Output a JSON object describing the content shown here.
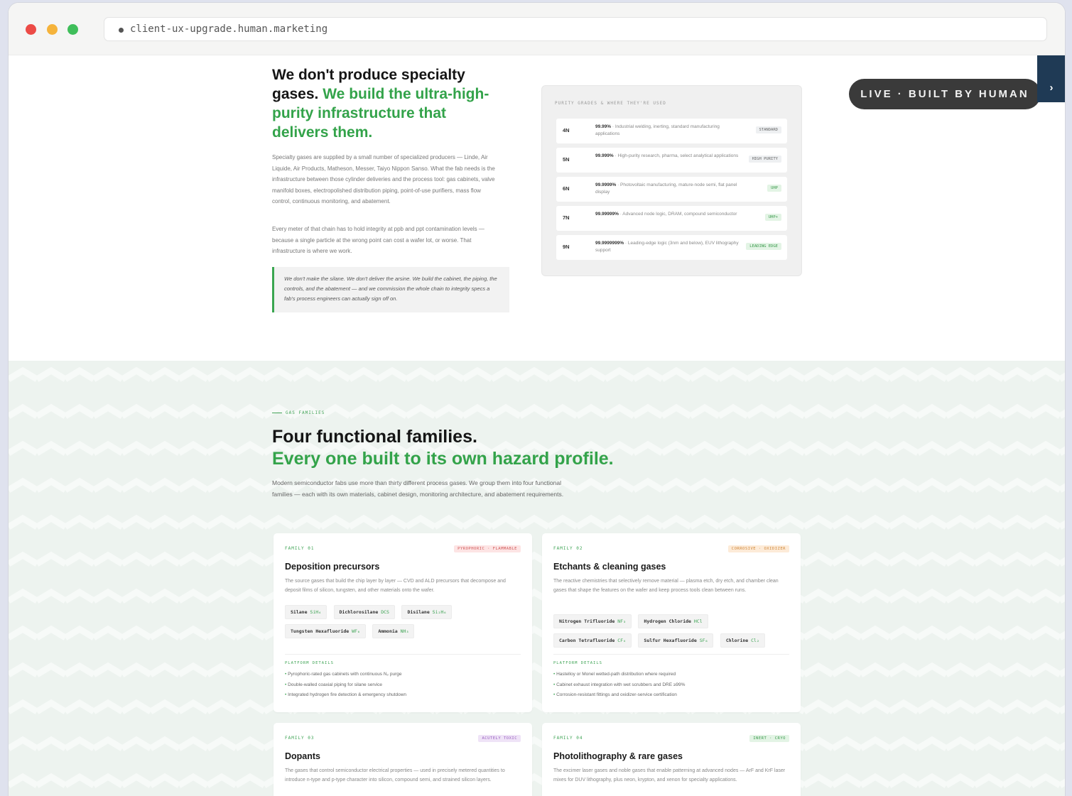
{
  "browser": {
    "url": "client-ux-upgrade.human.marketing",
    "traffic_lights": {
      "close": "#ec4b46",
      "minimize": "#f5b33b",
      "maximize": "#3fbe5a"
    }
  },
  "hero": {
    "title_dark": "We don't produce specialty gases.",
    "title_green": "We build the ultra-high-purity infrastructure that delivers them.",
    "para1": "Specialty gases are supplied by a small number of specialized producers — Linde, Air Liquide, Air Products, Matheson, Messer, Taiyo Nippon Sanso. What the fab needs is the infrastructure between those cylinder deliveries and the process tool: gas cabinets, valve manifold boxes, electropolished distribution piping, point-of-use purifiers, mass flow control, continuous monitoring, and abatement.",
    "para2": "Every meter of that chain has to hold integrity at ppb and ppt contamination levels — because a single particle at the wrong point can cost a wafer lot, or worse. That infrastructure is where we work.",
    "quote": "We don't make the silane. We don't deliver the arsine. We build the cabinet, the piping, the controls, and the abatement — and we commission the whole chain to integrity specs a fab's process engineers can actually sign off on."
  },
  "purity_panel": {
    "title": "PURITY GRADES & WHERE THEY'RE USED",
    "grades": [
      {
        "n": "4N",
        "purity": "99.99%",
        "desc": " · Industrial welding, inerting, standard manufacturing applications",
        "tag": "STANDARD"
      },
      {
        "n": "5N",
        "purity": "99.999%",
        "desc": " · High-purity research, pharma, select analytical applications",
        "tag": "HIGH PURITY"
      },
      {
        "n": "6N",
        "purity": "99.9999%",
        "desc": " · Photovoltaic manufacturing, mature-node semi, flat panel display",
        "tag": "UHP"
      },
      {
        "n": "7N",
        "purity": "99.99999%",
        "desc": " · Advanced node logic, DRAM, compound semiconductor",
        "tag": "UHP+"
      },
      {
        "n": "9N",
        "purity": "99.9999999%",
        "desc": " · Leading-edge logic (3nm and below), EUV lithography support",
        "tag": "LEADING EDGE"
      }
    ]
  },
  "live_badge": "LIVE · BUILT BY HUMAN",
  "side_tab_icon": "chevron-right-icon",
  "families": {
    "eyebrow": "GAS FAMILIES",
    "title_dark": "Four functional families.",
    "title_green": "Every one built to its own hazard profile.",
    "intro": "Modern semiconductor fabs use more than thirty different process gases. We group them into four functional families — each with its own materials, cabinet design, monitoring architecture, and abatement requirements.",
    "cards": [
      {
        "label": "FAMILY 01",
        "hazard": "PYROPHORIC · FLAMMABLE",
        "title": "Deposition precursors",
        "desc": "The source gases that build the chip layer by layer — CVD and ALD precursors that decompose and deposit films of silicon, tungsten, and other materials onto the wafer.",
        "chips": [
          {
            "name": "Silane",
            "formula": "SiH₄"
          },
          {
            "name": "Dichlorosilane",
            "formula": "DCS"
          },
          {
            "name": "Disilane",
            "formula": "Si₂H₆"
          },
          {
            "name": "Tungsten Hexafluoride",
            "formula": "WF₆"
          },
          {
            "name": "Ammonia",
            "formula": "NH₃"
          }
        ],
        "platform_label": "PLATFORM DETAILS",
        "bullets": [
          "Pyrophoric-rated gas cabinets with continuous N₂ purge",
          "Double-walled coaxial piping for silane service",
          "Integrated hydrogen fire detection & emergency shutdown"
        ]
      },
      {
        "label": "FAMILY 02",
        "hazard": "CORROSIVE · OXIDIZER",
        "title": "Etchants & cleaning gases",
        "desc": "The reactive chemistries that selectively remove material — plasma etch, dry etch, and chamber clean gases that shape the features on the wafer and keep process tools clean between runs.",
        "chips": [
          {
            "name": "Nitrogen Trifluoride",
            "formula": "NF₃"
          },
          {
            "name": "Hydrogen Chloride",
            "formula": "HCl"
          },
          {
            "name": "Carbon Tetrafluoride",
            "formula": "CF₄"
          },
          {
            "name": "Sulfur Hexafluoride",
            "formula": "SF₆"
          },
          {
            "name": "Chlorine",
            "formula": "Cl₂"
          }
        ],
        "platform_label": "PLATFORM DETAILS",
        "bullets": [
          "Hastelloy or Monel wetted-path distribution where required",
          "Cabinet exhaust integration with wet scrubbers and DRE ≥99%",
          "Corrosion-resistant fittings and oxidizer-service certification"
        ]
      },
      {
        "label": "FAMILY 03",
        "hazard": "ACUTELY TOXIC",
        "title": "Dopants",
        "desc": "The gases that control semiconductor electrical properties — used in precisely metered quantities to introduce n-type and p-type character into silicon, compound semi, and strained silicon layers."
      },
      {
        "label": "FAMILY 04",
        "hazard": "INERT · CRYO",
        "title": "Photolithography & rare gases",
        "desc": "The excimer laser gases and noble gases that enable patterning at advanced nodes — ArF and KrF laser mixes for DUV lithography, plus neon, krypton, and xenon for specialty applications."
      }
    ]
  },
  "colors": {
    "accent_green": "#33a34a",
    "section_bg": "#edf3ef",
    "pill_bg": "#3a3a3a",
    "side_tab_bg": "#1f3a55"
  }
}
